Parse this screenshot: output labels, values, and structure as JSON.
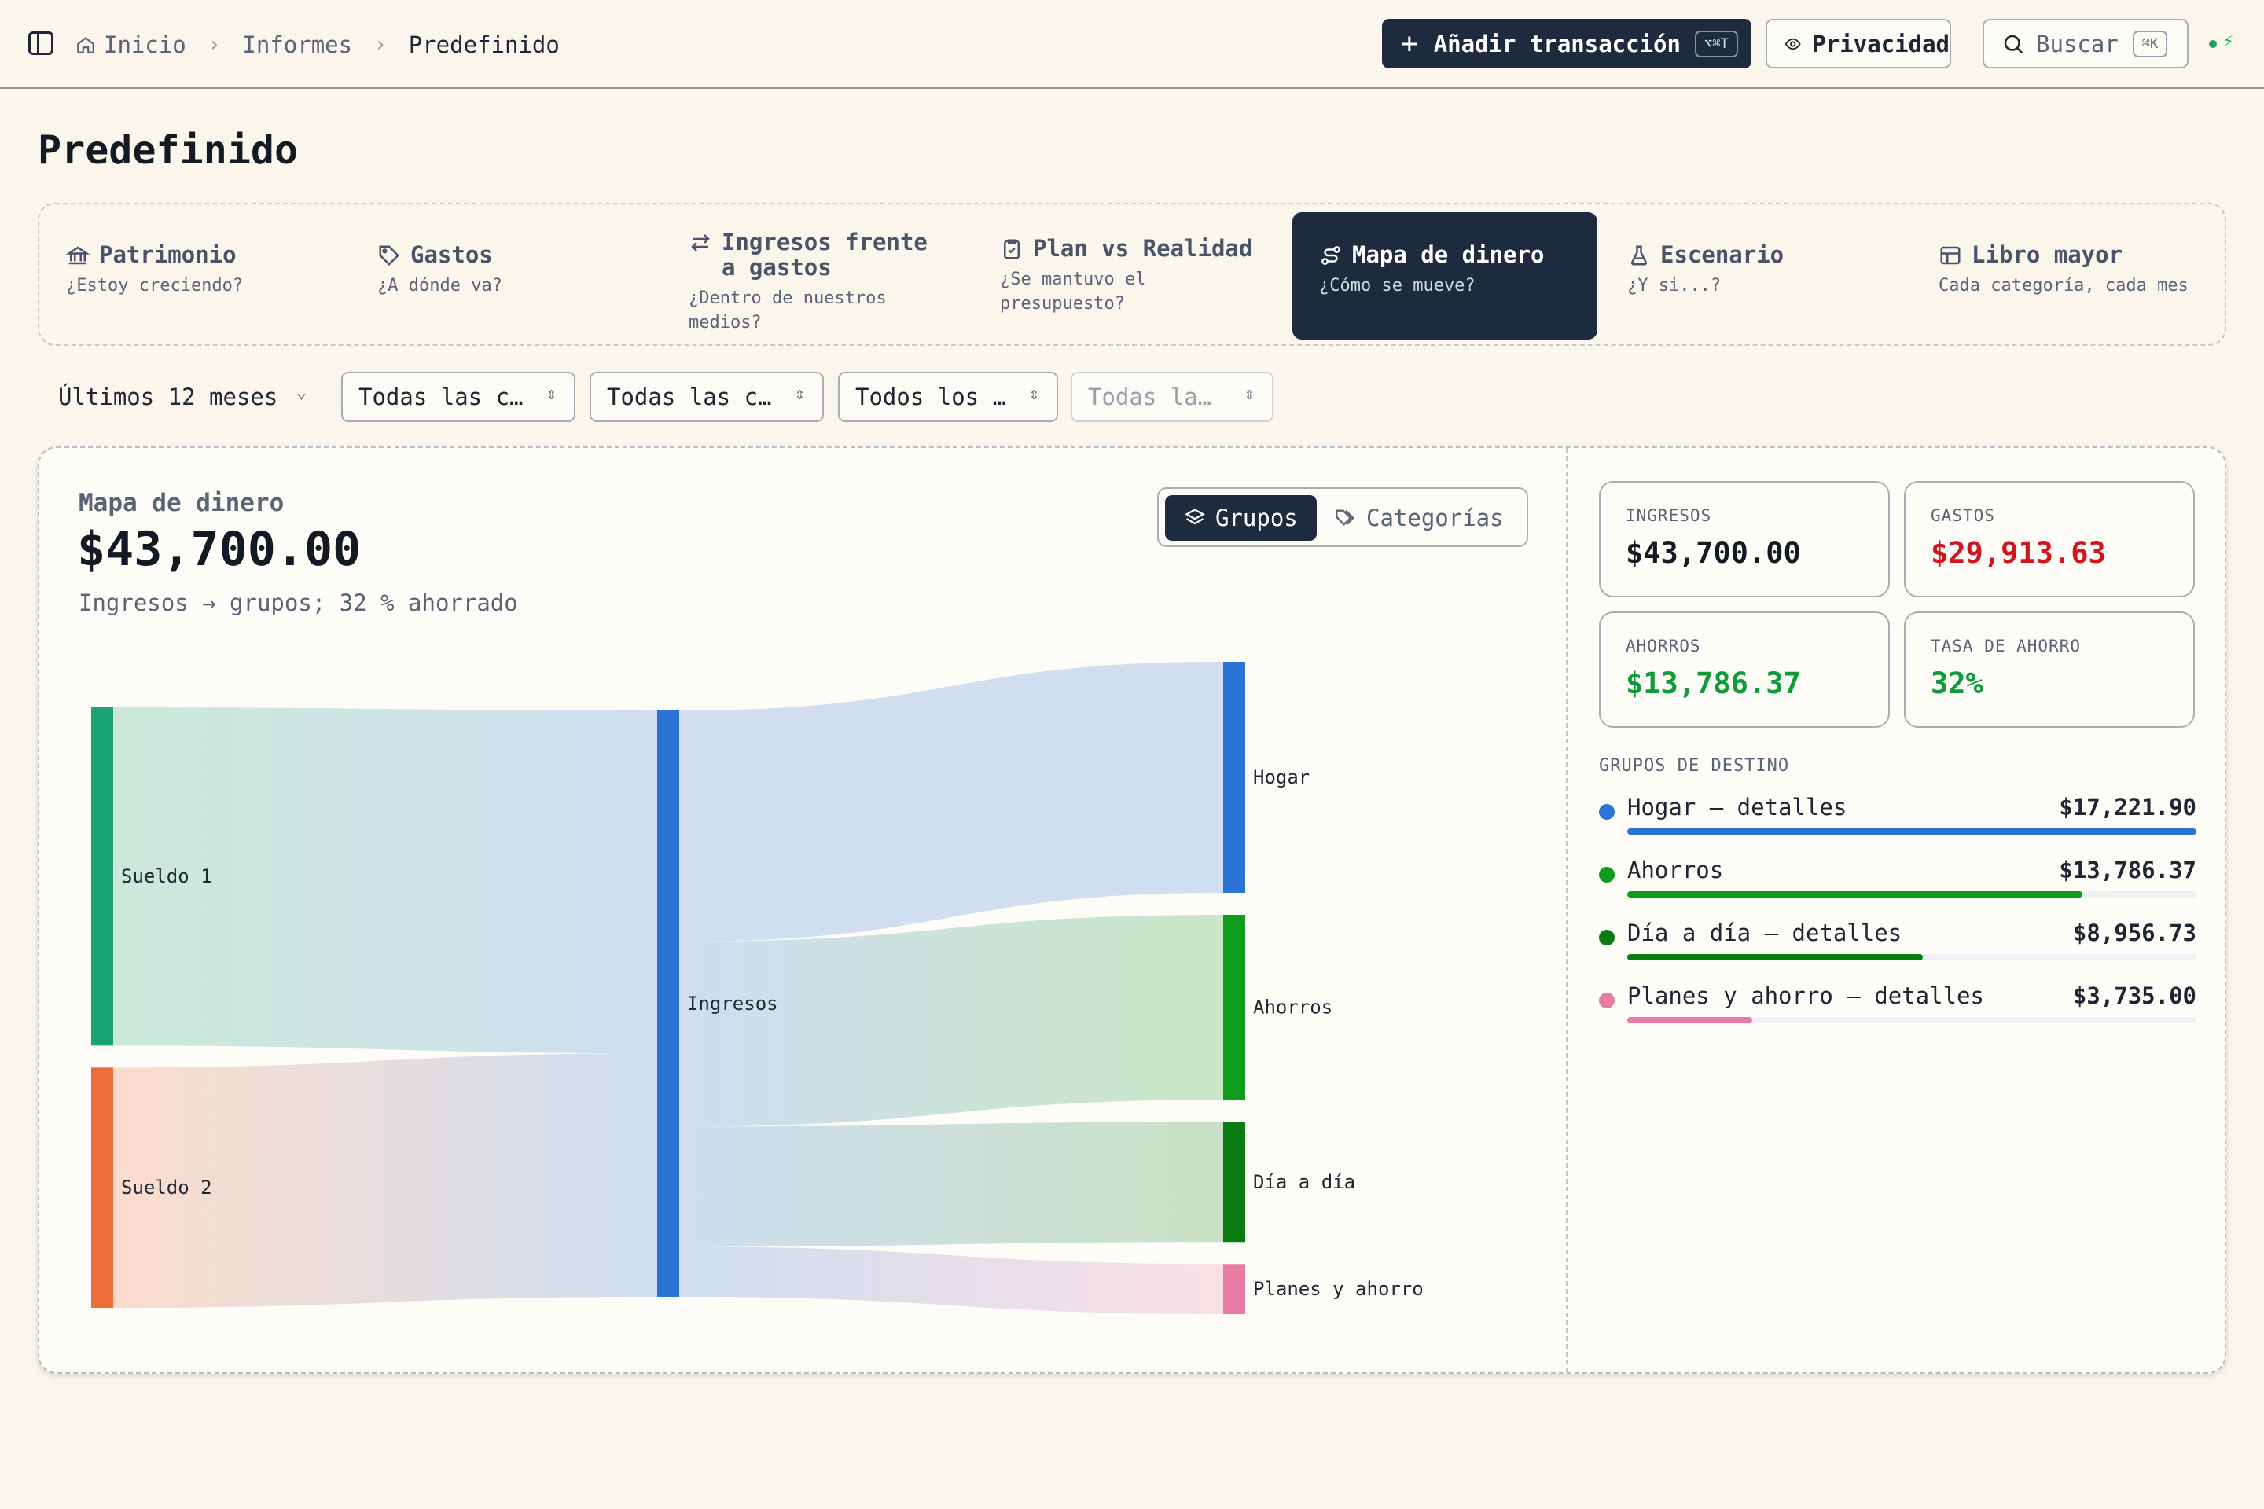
{
  "breadcrumb": {
    "home": "Inicio",
    "reports": "Informes",
    "current": "Predefinido"
  },
  "toolbar": {
    "add_label": "Añadir transacción",
    "add_shortcut": "⌥⌘T",
    "privacy_label": "Privacidad",
    "search_label": "Buscar",
    "search_shortcut": "⌘K"
  },
  "page_title": "Predefinido",
  "tabs": [
    {
      "title": "Patrimonio",
      "subtitle": "¿Estoy creciendo?",
      "icon": "bank-icon"
    },
    {
      "title": "Gastos",
      "subtitle": "¿A dónde va?",
      "icon": "tag-icon"
    },
    {
      "title": "Ingresos frente a gastos",
      "subtitle": "¿Dentro de nuestros medios?",
      "icon": "arrows-left-right-icon"
    },
    {
      "title": "Plan vs Realidad",
      "subtitle": "¿Se mantuvo el presupuesto?",
      "icon": "clipboard-check-icon"
    },
    {
      "title": "Mapa de dinero",
      "subtitle": "¿Cómo se mueve?",
      "icon": "route-icon",
      "active": true
    },
    {
      "title": "Escenario",
      "subtitle": "¿Y si...?",
      "icon": "flask-icon"
    },
    {
      "title": "Libro mayor",
      "subtitle": "Cada categoría, cada mes",
      "icon": "table-icon"
    }
  ],
  "filters": {
    "period": "Últimos 12 meses",
    "accounts": "Todas las c…",
    "categories": "Todas las c…",
    "all": "Todos los …",
    "tags": "Todas la…"
  },
  "money_map": {
    "label": "Mapa de dinero",
    "total": "$43,700.00",
    "subtitle": "Ingresos → grupos; 32 % ahorrado",
    "view_groups": "Grupos",
    "view_categories": "Categorías"
  },
  "chart_data": {
    "type": "sankey",
    "nodes": [
      "Sueldo 1",
      "Sueldo 2",
      "Ingresos",
      "Hogar",
      "Ahorros",
      "Día a día",
      "Planes y ahorro"
    ],
    "links": [
      {
        "source": "Sueldo 1",
        "target": "Ingresos",
        "value": 25550
      },
      {
        "source": "Sueldo 2",
        "target": "Ingresos",
        "value": 18150
      },
      {
        "source": "Ingresos",
        "target": "Hogar",
        "value": 17221.9
      },
      {
        "source": "Ingresos",
        "target": "Ahorros",
        "value": 13786.37
      },
      {
        "source": "Ingresos",
        "target": "Día a día",
        "value": 8956.73
      },
      {
        "source": "Ingresos",
        "target": "Planes y ahorro",
        "value": 3735.0
      }
    ],
    "colors": {
      "Sueldo 1": "#1aa374",
      "Sueldo 2": "#ef6c3b",
      "Ingresos": "#2b73d4",
      "Hogar": "#2b73d4",
      "Ahorros": "#0f9b1c",
      "Día a día": "#0a7d12",
      "Planes y ahorro": "#e87aa3"
    }
  },
  "stats": {
    "income_label": "INGRESOS",
    "income_value": "$43,700.00",
    "expenses_label": "GASTOS",
    "expenses_value": "$29,913.63",
    "savings_label": "AHORROS",
    "savings_value": "$13,786.37",
    "rate_label": "TASA DE AHORRO",
    "rate_value": "32%",
    "colors": {
      "expense": "#d4141c",
      "positive": "#0f9b3a"
    }
  },
  "groups": {
    "heading": "GRUPOS DE DESTINO",
    "items": [
      {
        "name": "Hogar — detalles",
        "amount": "$17,221.90",
        "share": 1.0,
        "color": "#2b73d4"
      },
      {
        "name": "Ahorros",
        "amount": "$13,786.37",
        "share": 0.8,
        "color": "#0f9b1c"
      },
      {
        "name": "Día a día — detalles",
        "amount": "$8,956.73",
        "share": 0.52,
        "color": "#0a7d12"
      },
      {
        "name": "Planes y ahorro — detalles",
        "amount": "$3,735.00",
        "share": 0.22,
        "color": "#e87aa3"
      }
    ]
  }
}
